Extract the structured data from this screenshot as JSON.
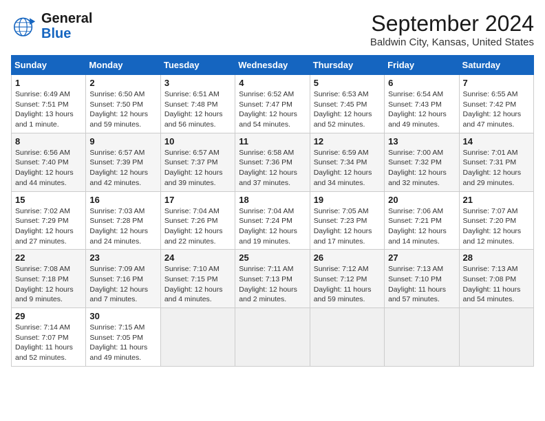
{
  "brand": {
    "name_line1": "General",
    "name_line2": "Blue"
  },
  "title": "September 2024",
  "subtitle": "Baldwin City, Kansas, United States",
  "days_of_week": [
    "Sunday",
    "Monday",
    "Tuesday",
    "Wednesday",
    "Thursday",
    "Friday",
    "Saturday"
  ],
  "weeks": [
    [
      {
        "day": "1",
        "sunrise": "6:49 AM",
        "sunset": "7:51 PM",
        "daylight": "13 hours and 1 minute."
      },
      {
        "day": "2",
        "sunrise": "6:50 AM",
        "sunset": "7:50 PM",
        "daylight": "12 hours and 59 minutes."
      },
      {
        "day": "3",
        "sunrise": "6:51 AM",
        "sunset": "7:48 PM",
        "daylight": "12 hours and 56 minutes."
      },
      {
        "day": "4",
        "sunrise": "6:52 AM",
        "sunset": "7:47 PM",
        "daylight": "12 hours and 54 minutes."
      },
      {
        "day": "5",
        "sunrise": "6:53 AM",
        "sunset": "7:45 PM",
        "daylight": "12 hours and 52 minutes."
      },
      {
        "day": "6",
        "sunrise": "6:54 AM",
        "sunset": "7:43 PM",
        "daylight": "12 hours and 49 minutes."
      },
      {
        "day": "7",
        "sunrise": "6:55 AM",
        "sunset": "7:42 PM",
        "daylight": "12 hours and 47 minutes."
      }
    ],
    [
      {
        "day": "8",
        "sunrise": "6:56 AM",
        "sunset": "7:40 PM",
        "daylight": "12 hours and 44 minutes."
      },
      {
        "day": "9",
        "sunrise": "6:57 AM",
        "sunset": "7:39 PM",
        "daylight": "12 hours and 42 minutes."
      },
      {
        "day": "10",
        "sunrise": "6:57 AM",
        "sunset": "7:37 PM",
        "daylight": "12 hours and 39 minutes."
      },
      {
        "day": "11",
        "sunrise": "6:58 AM",
        "sunset": "7:36 PM",
        "daylight": "12 hours and 37 minutes."
      },
      {
        "day": "12",
        "sunrise": "6:59 AM",
        "sunset": "7:34 PM",
        "daylight": "12 hours and 34 minutes."
      },
      {
        "day": "13",
        "sunrise": "7:00 AM",
        "sunset": "7:32 PM",
        "daylight": "12 hours and 32 minutes."
      },
      {
        "day": "14",
        "sunrise": "7:01 AM",
        "sunset": "7:31 PM",
        "daylight": "12 hours and 29 minutes."
      }
    ],
    [
      {
        "day": "15",
        "sunrise": "7:02 AM",
        "sunset": "7:29 PM",
        "daylight": "12 hours and 27 minutes."
      },
      {
        "day": "16",
        "sunrise": "7:03 AM",
        "sunset": "7:28 PM",
        "daylight": "12 hours and 24 minutes."
      },
      {
        "day": "17",
        "sunrise": "7:04 AM",
        "sunset": "7:26 PM",
        "daylight": "12 hours and 22 minutes."
      },
      {
        "day": "18",
        "sunrise": "7:04 AM",
        "sunset": "7:24 PM",
        "daylight": "12 hours and 19 minutes."
      },
      {
        "day": "19",
        "sunrise": "7:05 AM",
        "sunset": "7:23 PM",
        "daylight": "12 hours and 17 minutes."
      },
      {
        "day": "20",
        "sunrise": "7:06 AM",
        "sunset": "7:21 PM",
        "daylight": "12 hours and 14 minutes."
      },
      {
        "day": "21",
        "sunrise": "7:07 AM",
        "sunset": "7:20 PM",
        "daylight": "12 hours and 12 minutes."
      }
    ],
    [
      {
        "day": "22",
        "sunrise": "7:08 AM",
        "sunset": "7:18 PM",
        "daylight": "12 hours and 9 minutes."
      },
      {
        "day": "23",
        "sunrise": "7:09 AM",
        "sunset": "7:16 PM",
        "daylight": "12 hours and 7 minutes."
      },
      {
        "day": "24",
        "sunrise": "7:10 AM",
        "sunset": "7:15 PM",
        "daylight": "12 hours and 4 minutes."
      },
      {
        "day": "25",
        "sunrise": "7:11 AM",
        "sunset": "7:13 PM",
        "daylight": "12 hours and 2 minutes."
      },
      {
        "day": "26",
        "sunrise": "7:12 AM",
        "sunset": "7:12 PM",
        "daylight": "11 hours and 59 minutes."
      },
      {
        "day": "27",
        "sunrise": "7:13 AM",
        "sunset": "7:10 PM",
        "daylight": "11 hours and 57 minutes."
      },
      {
        "day": "28",
        "sunrise": "7:13 AM",
        "sunset": "7:08 PM",
        "daylight": "11 hours and 54 minutes."
      }
    ],
    [
      {
        "day": "29",
        "sunrise": "7:14 AM",
        "sunset": "7:07 PM",
        "daylight": "11 hours and 52 minutes."
      },
      {
        "day": "30",
        "sunrise": "7:15 AM",
        "sunset": "7:05 PM",
        "daylight": "11 hours and 49 minutes."
      },
      null,
      null,
      null,
      null,
      null
    ]
  ],
  "labels": {
    "sunrise": "Sunrise:",
    "sunset": "Sunset:",
    "daylight": "Daylight hours"
  }
}
